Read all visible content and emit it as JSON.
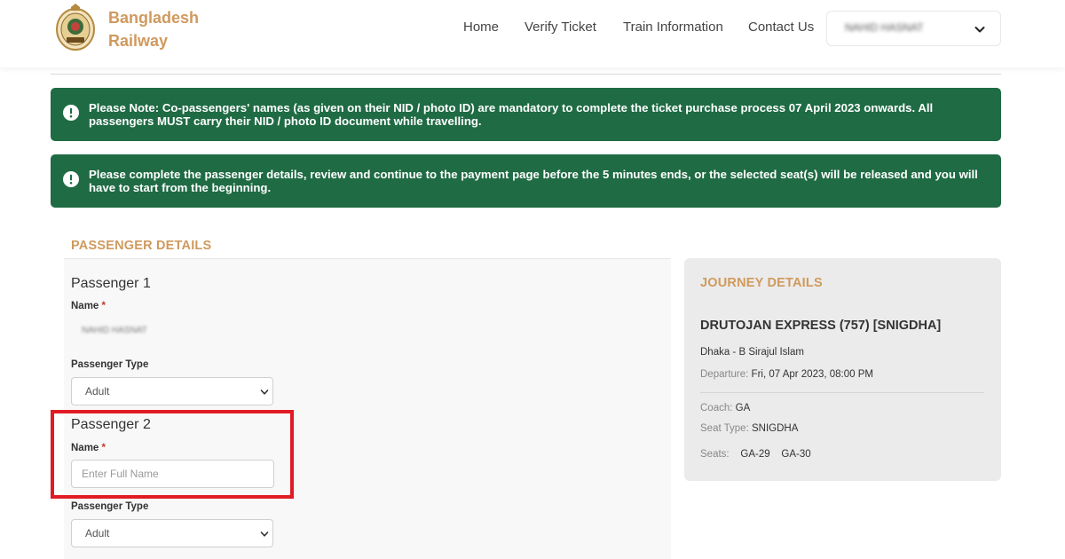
{
  "header": {
    "brand_line1": "Bangladesh",
    "brand_line2": "Railway",
    "nav": [
      "Home",
      "Verify Ticket",
      "Train Information",
      "Contact Us"
    ],
    "user_name": "NAHID HASNAT",
    "brand_color": "#d09a5e"
  },
  "notices": [
    {
      "text": "Please Note: Co-passengers' names (as given on their NID / photo ID) are mandatory to complete the ticket purchase process 07 April 2023 onwards. All passengers MUST carry their NID / photo ID document while travelling.",
      "color": "#1f6b44",
      "icon": "info-icon"
    },
    {
      "text": "Please complete the passenger details, review and continue to the payment page before the 5 minutes ends, or the selected seat(s) will be released and you will have to start from the beginning.",
      "color": "#1f6b44",
      "icon": "info-icon"
    }
  ],
  "passenger_details": {
    "title": "PASSENGER DETAILS",
    "required_mark": "*",
    "passengers": [
      {
        "heading": "Passenger 1",
        "name_label": "Name",
        "name_value": "NAHID HASNAT",
        "type_label": "Passenger Type",
        "type_value": "Adult"
      },
      {
        "heading": "Passenger 2",
        "name_label": "Name",
        "name_placeholder": "Enter Full Name",
        "type_label": "Passenger Type",
        "type_value": "Adult"
      }
    ],
    "highlight_color": "#e01b24"
  },
  "journey": {
    "title": "JOURNEY DETAILS",
    "train": "DRUTOJAN EXPRESS (757) [SNIGDHA]",
    "route": "Dhaka - B Sirajul Islam",
    "departure_label": "Departure:",
    "departure_value": "Fri, 07 Apr 2023, 08:00 PM",
    "coach_label": "Coach:",
    "coach_value": "GA",
    "seat_type_label": "Seat Type:",
    "seat_type_value": "SNIGDHA",
    "seats_label": "Seats:",
    "seats": [
      "GA-29",
      "GA-30"
    ]
  }
}
